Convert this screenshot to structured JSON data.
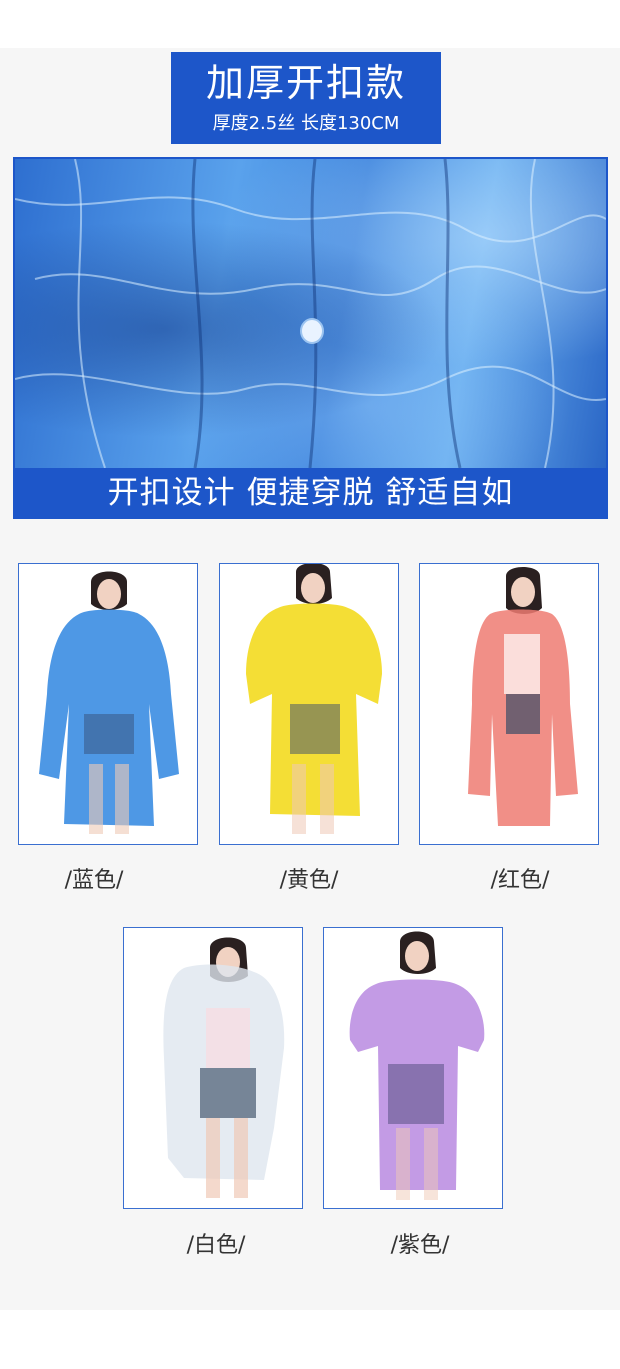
{
  "header": {
    "title": "加厚开扣款",
    "subtitle": "厚度2.5丝  长度130CM",
    "bg_color": "#1d56c9"
  },
  "hero": {
    "caption": "开扣设计 便捷穿脱 舒适自如"
  },
  "products": [
    {
      "label": "/蓝色/",
      "coat_color": "#2f86e0"
    },
    {
      "label": "/黄色/",
      "coat_color": "#f3da1f"
    },
    {
      "label": "/红色/",
      "coat_color": "#ee7b72"
    },
    {
      "label": "/白色/",
      "coat_color": "#eef2f7"
    },
    {
      "label": "/紫色/",
      "coat_color": "#b98ae0"
    }
  ]
}
